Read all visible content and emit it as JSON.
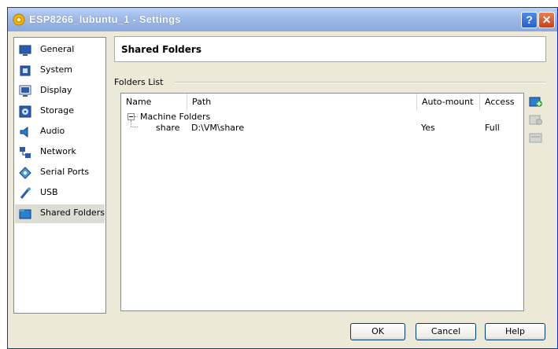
{
  "window": {
    "title": "ESP8266_lubuntu_1 - Settings",
    "help_label": "?",
    "close_label": "✕"
  },
  "nav": {
    "items": [
      {
        "label": "General",
        "icon": "monitor-icon"
      },
      {
        "label": "System",
        "icon": "chip-icon"
      },
      {
        "label": "Display",
        "icon": "display-icon"
      },
      {
        "label": "Storage",
        "icon": "disk-icon"
      },
      {
        "label": "Audio",
        "icon": "speaker-icon"
      },
      {
        "label": "Network",
        "icon": "network-icon"
      },
      {
        "label": "Serial Ports",
        "icon": "serial-port-icon"
      },
      {
        "label": "USB",
        "icon": "usb-icon"
      },
      {
        "label": "Shared Folders",
        "icon": "folder-icon"
      }
    ],
    "selected": "Shared Folders"
  },
  "header": {
    "title": "Shared Folders"
  },
  "folders_list": {
    "label": "Folders List",
    "columns": [
      "Name",
      "Path",
      "Auto-mount",
      "Access"
    ],
    "group": "Machine Folders",
    "rows": [
      {
        "name": "share",
        "path": "D:\\VM\\share",
        "auto_mount": "Yes",
        "access": "Full"
      }
    ]
  },
  "side_tools": [
    "add-folder-icon",
    "edit-folder-icon",
    "remove-folder-icon"
  ],
  "buttons": {
    "ok": "OK",
    "cancel": "Cancel",
    "help": "Help"
  },
  "colors": {
    "title_bar": "#8aa9de",
    "dialog_bg": "#ece9d8",
    "selected_item": "#dcdcd4"
  }
}
